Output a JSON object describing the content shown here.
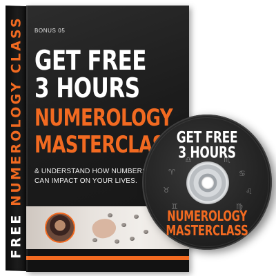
{
  "product": {
    "spine": {
      "word1": "FREE",
      "word2": "NUMEROLOGY CLASS"
    },
    "front": {
      "bonus_label": "BONUS 05",
      "headline_line1": "GET FREE",
      "headline_line2": "3 HOURS",
      "title_line1": "NUMEROLOGY",
      "title_line2": "MASTERCLASS",
      "subtitle_line1": "& UNDERSTAND HOW NUMBERS",
      "subtitle_line2": "CAN IMPACT ON YOUR LIVES."
    },
    "disc": {
      "line1": "GET FREE",
      "line2": "3 HOURS",
      "line3": "NUMEROLOGY",
      "line4": "MASTERCLASS"
    }
  },
  "colors": {
    "accent": "#f26a21",
    "dark": "#1c1c1c",
    "text": "#ffffff"
  }
}
